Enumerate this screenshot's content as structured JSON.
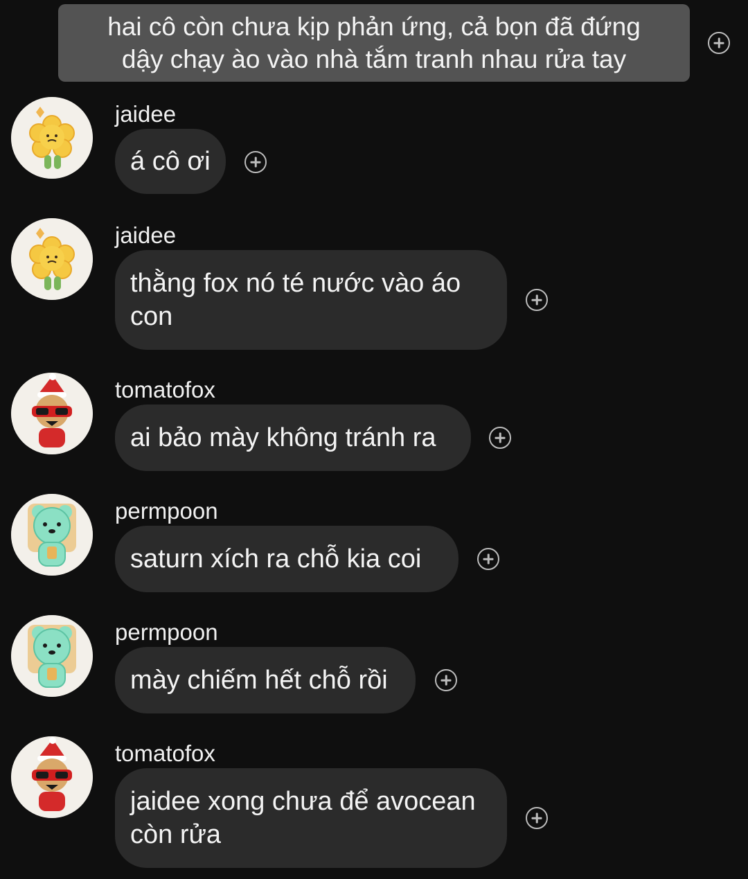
{
  "narration": {
    "text": "hai cô còn chưa kịp phản ứng, cả bọn đã đứng dậy chạy ào vào nhà tắm tranh nhau rửa tay"
  },
  "messages": [
    {
      "sender": "jaidee",
      "text": "á cô ơi",
      "avatar": "sunflower-cookie-avatar"
    },
    {
      "sender": "jaidee",
      "text": "thằng fox nó té nước vào áo con",
      "avatar": "sunflower-cookie-avatar"
    },
    {
      "sender": "tomatofox",
      "text": "ai bảo mày không tránh ra",
      "avatar": "red-fox-cookie-avatar"
    },
    {
      "sender": "permpoon",
      "text": "saturn xích ra chỗ kia coi",
      "avatar": "mint-bear-cookie-avatar"
    },
    {
      "sender": "permpoon",
      "text": "mày chiếm hết chỗ rồi",
      "avatar": "mint-bear-cookie-avatar"
    },
    {
      "sender": "tomatofox",
      "text": "jaidee xong chưa để avocean còn rửa",
      "avatar": "red-fox-cookie-avatar"
    }
  ],
  "icons": {
    "reaction": "add-reaction-icon"
  },
  "colors": {
    "background": "#0f0f0f",
    "bubble": "#2b2b2b",
    "narration": "#535353"
  }
}
